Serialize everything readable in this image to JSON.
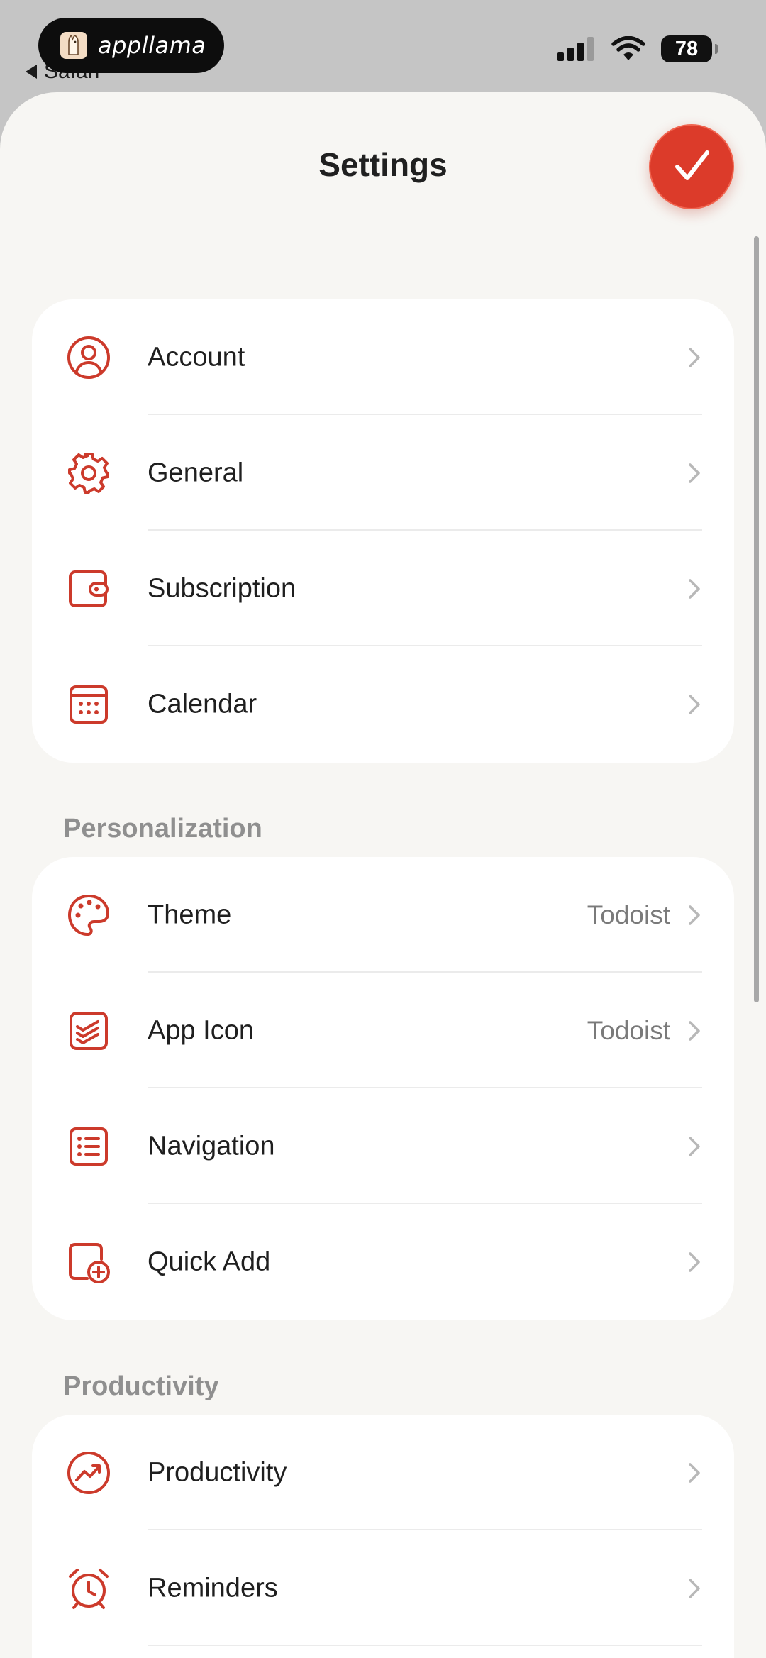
{
  "status_bar": {
    "back_label": "Safari",
    "brand": "appllama",
    "battery": "78"
  },
  "header": {
    "title": "Settings"
  },
  "colors": {
    "accent": "#dc3b2a",
    "sheet_background": "#f7f6f3"
  },
  "account_group": {
    "items": [
      {
        "label": "Account",
        "icon": "user-circle-icon"
      },
      {
        "label": "General",
        "icon": "gear-icon"
      },
      {
        "label": "Subscription",
        "icon": "wallet-icon"
      },
      {
        "label": "Calendar",
        "icon": "calendar-icon"
      }
    ]
  },
  "personalization_group": {
    "header": "Personalization",
    "items": [
      {
        "label": "Theme",
        "value": "Todoist",
        "icon": "palette-icon"
      },
      {
        "label": "App Icon",
        "value": "Todoist",
        "icon": "app-icon-icon"
      },
      {
        "label": "Navigation",
        "icon": "list-icon"
      },
      {
        "label": "Quick Add",
        "icon": "quick-add-icon"
      }
    ]
  },
  "productivity_group": {
    "header": "Productivity",
    "items": [
      {
        "label": "Productivity",
        "icon": "trend-icon"
      },
      {
        "label": "Reminders",
        "icon": "alarm-clock-icon"
      }
    ]
  }
}
